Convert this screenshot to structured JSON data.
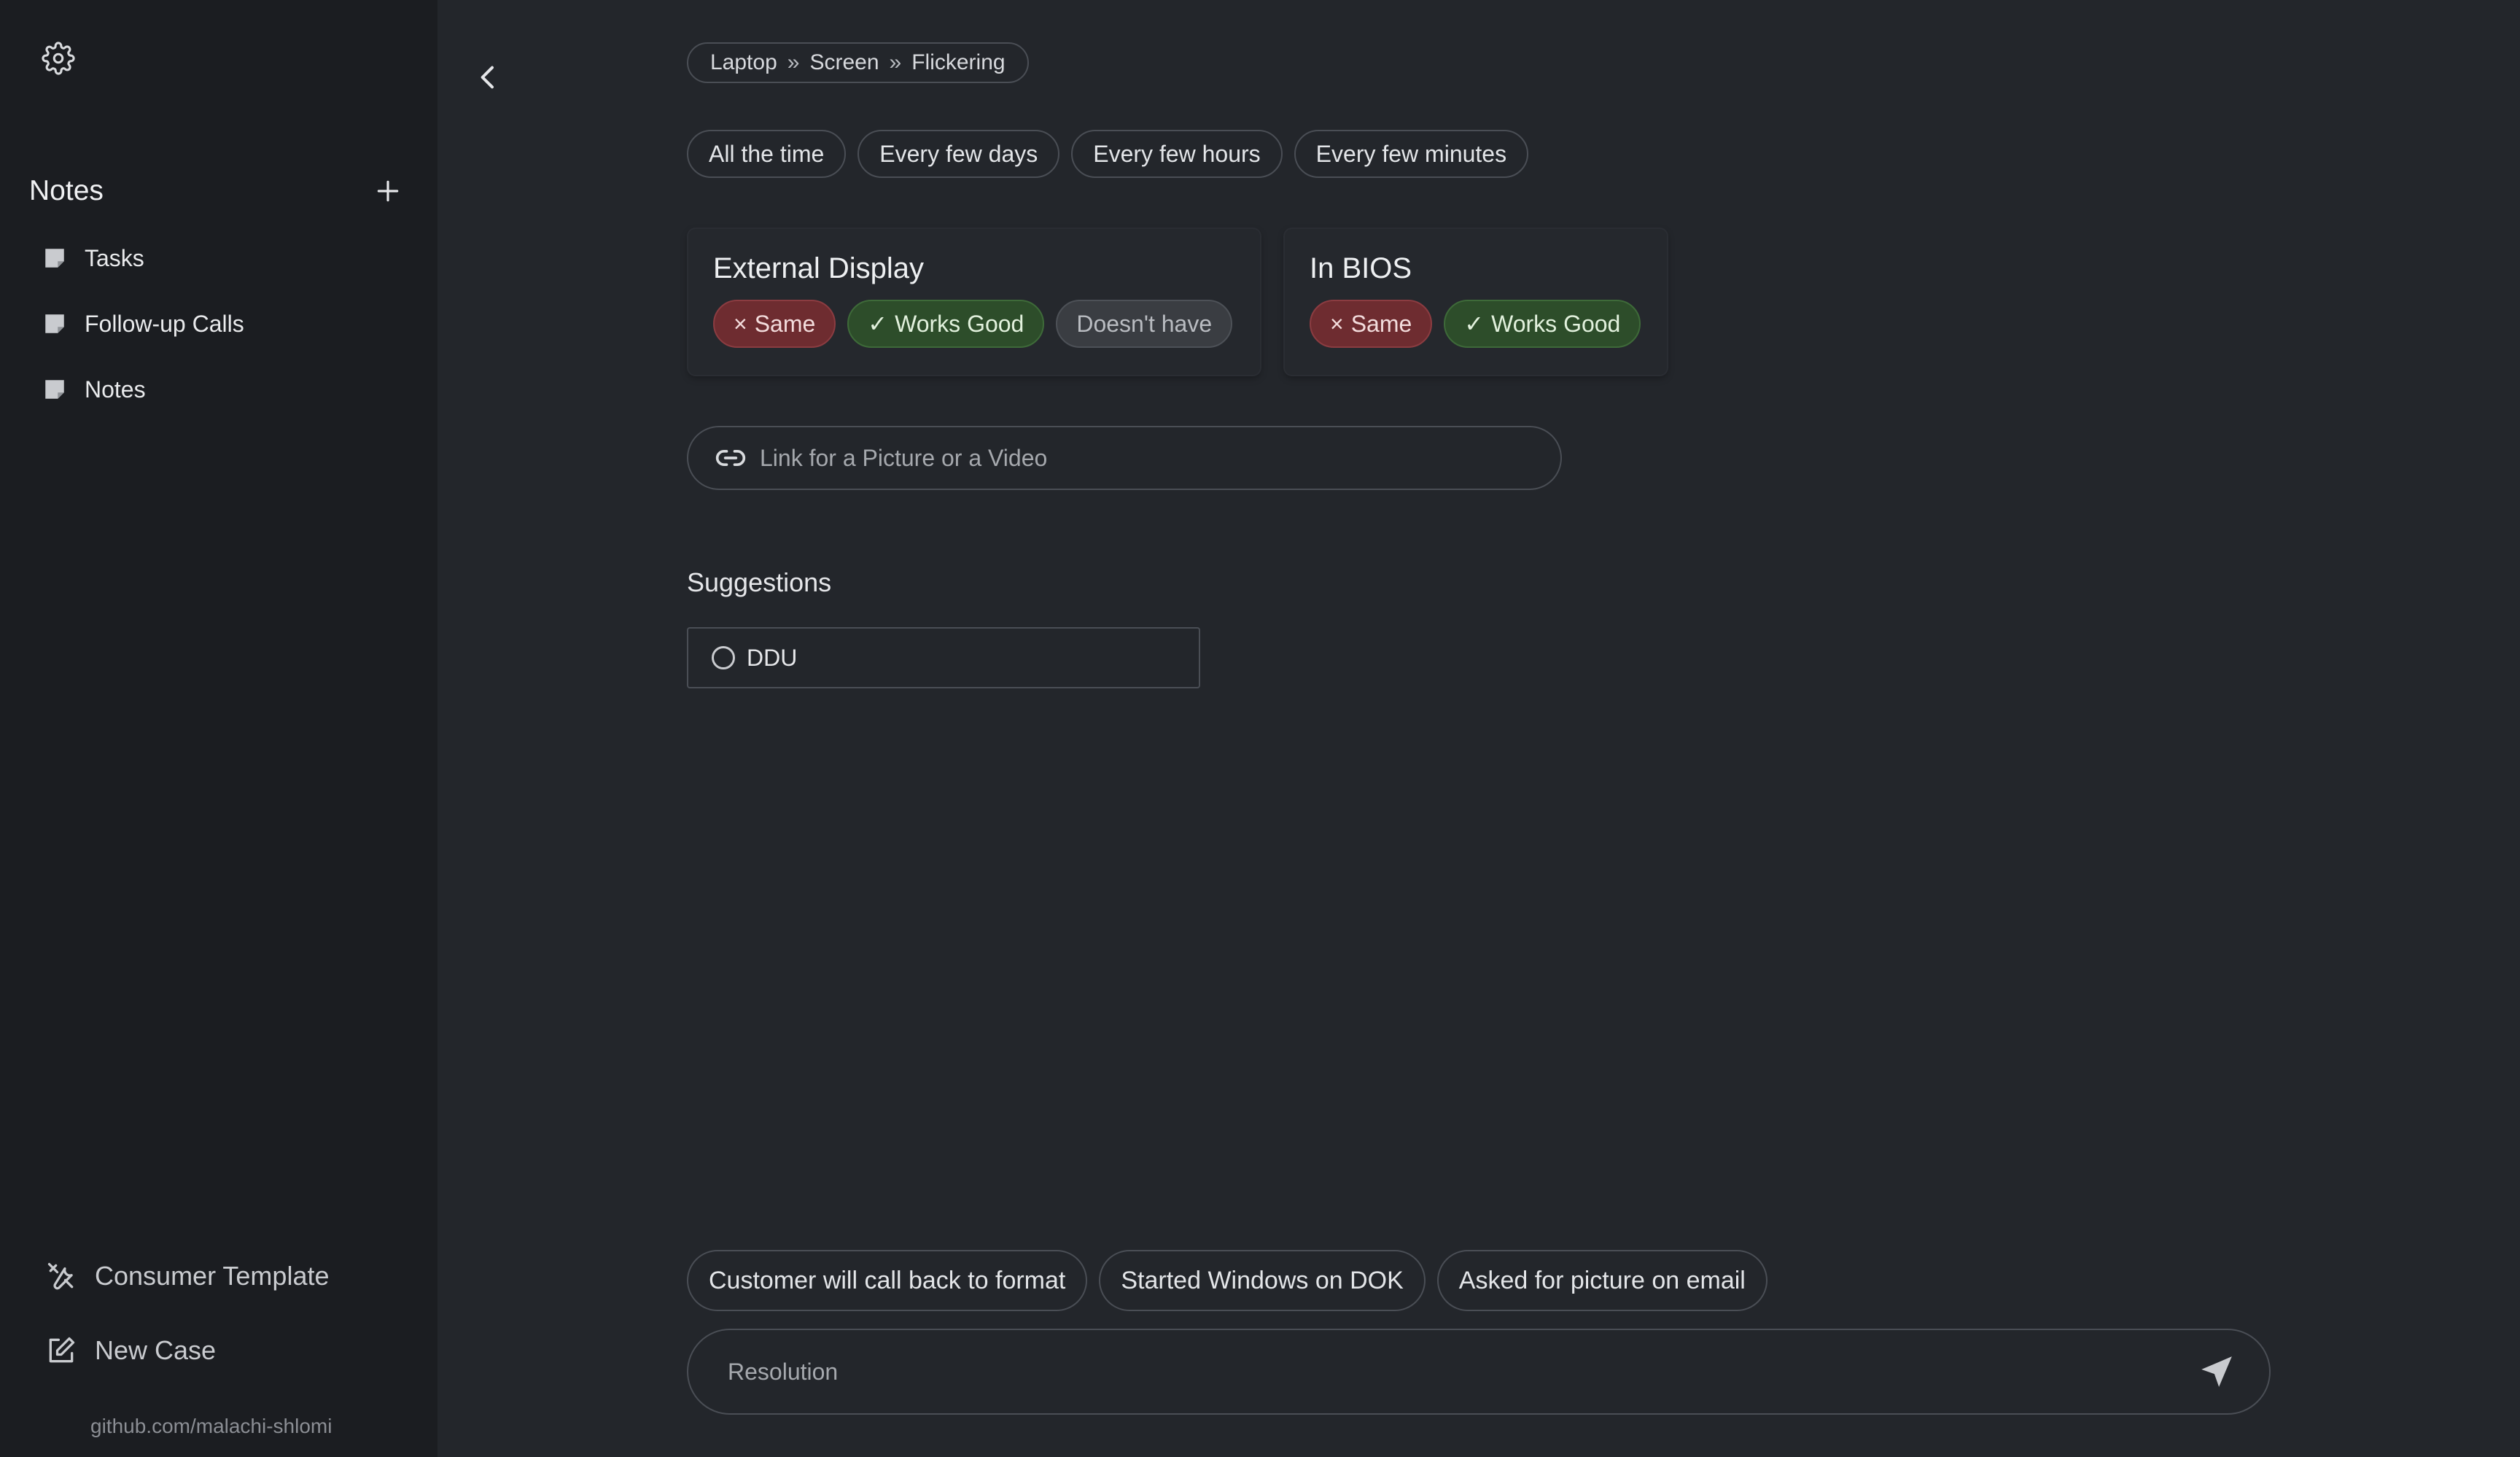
{
  "sidebar": {
    "settings_icon": "gear-icon",
    "notes_title": "Notes",
    "add_icon": "plus-icon",
    "items": [
      {
        "label": "Tasks",
        "icon": "note-icon"
      },
      {
        "label": "Follow-up Calls",
        "icon": "note-icon"
      },
      {
        "label": "Notes",
        "icon": "note-icon"
      }
    ],
    "consumer_template": "Consumer Template",
    "new_case": "New Case",
    "footer": "github.com/malachi-shlomi"
  },
  "breadcrumb": {
    "items": [
      "Laptop",
      "Screen",
      "Flickering"
    ],
    "separator": "»"
  },
  "frequency": {
    "options": [
      "All the time",
      "Every few days",
      "Every few hours",
      "Every few minutes"
    ]
  },
  "cards": {
    "external_display": {
      "title": "External Display",
      "chips": [
        {
          "label": "Same",
          "status": "negative",
          "symbol": "×"
        },
        {
          "label": "Works Good",
          "status": "positive",
          "symbol": "✓"
        },
        {
          "label": "Doesn't have",
          "status": "neutral",
          "symbol": ""
        }
      ]
    },
    "in_bios": {
      "title": "In BIOS",
      "chips": [
        {
          "label": "Same",
          "status": "negative",
          "symbol": "×"
        },
        {
          "label": "Works Good",
          "status": "positive",
          "symbol": "✓"
        }
      ]
    }
  },
  "media_link": {
    "placeholder": "Link for a Picture or a Video",
    "value": ""
  },
  "suggestions": {
    "title": "Suggestions",
    "items": [
      {
        "label": "DDU",
        "checked": false
      }
    ]
  },
  "quick_resolutions": [
    "Customer will call back to format",
    "Started Windows on DOK",
    "Asked for picture on email"
  ],
  "resolution": {
    "placeholder": "Resolution",
    "value": ""
  },
  "colors": {
    "background": "#23262b",
    "sidebar": "#1b1d21",
    "negative": "#6e2c30",
    "positive": "#2d4d2a",
    "neutral": "#3a3d42"
  }
}
